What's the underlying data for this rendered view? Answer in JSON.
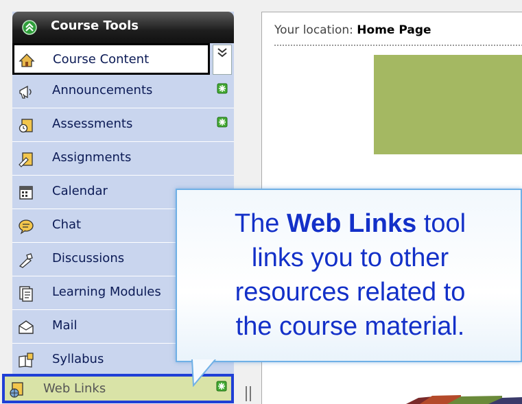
{
  "panel": {
    "title": "Course Tools",
    "items": [
      {
        "label": "Course Content",
        "icon": "home-icon"
      },
      {
        "label": "Announcements",
        "icon": "megaphone-icon",
        "new": true
      },
      {
        "label": "Assessments",
        "icon": "assessment-icon",
        "new": true
      },
      {
        "label": "Assignments",
        "icon": "assignment-icon"
      },
      {
        "label": "Calendar",
        "icon": "calendar-icon"
      },
      {
        "label": "Chat",
        "icon": "chat-icon"
      },
      {
        "label": "Discussions",
        "icon": "discussion-icon"
      },
      {
        "label": "Learning Modules",
        "icon": "learning-modules-icon"
      },
      {
        "label": "Mail",
        "icon": "mail-icon"
      },
      {
        "label": "Syllabus",
        "icon": "syllabus-icon"
      },
      {
        "label": "Web Links",
        "icon": "web-links-icon",
        "new": true
      }
    ]
  },
  "content": {
    "location_label": "Your location:",
    "location_page": "Home Page"
  },
  "callout": {
    "line1_pre": "The ",
    "line1_bold": "Web Links",
    "line1_post": " tool",
    "line2": "links you to other",
    "line3": "resources related to",
    "line4": "the course material."
  },
  "colors": {
    "panel_bg": "#c9d5ee",
    "header_bg": "#1e1e1e",
    "highlight_border": "#1f3fd6",
    "highlight_bg": "#d9e3a7",
    "callout_text": "#1330c8",
    "callout_border": "#6fb0e6",
    "banner": "#a4b862",
    "new_badge": "#44aa33"
  }
}
